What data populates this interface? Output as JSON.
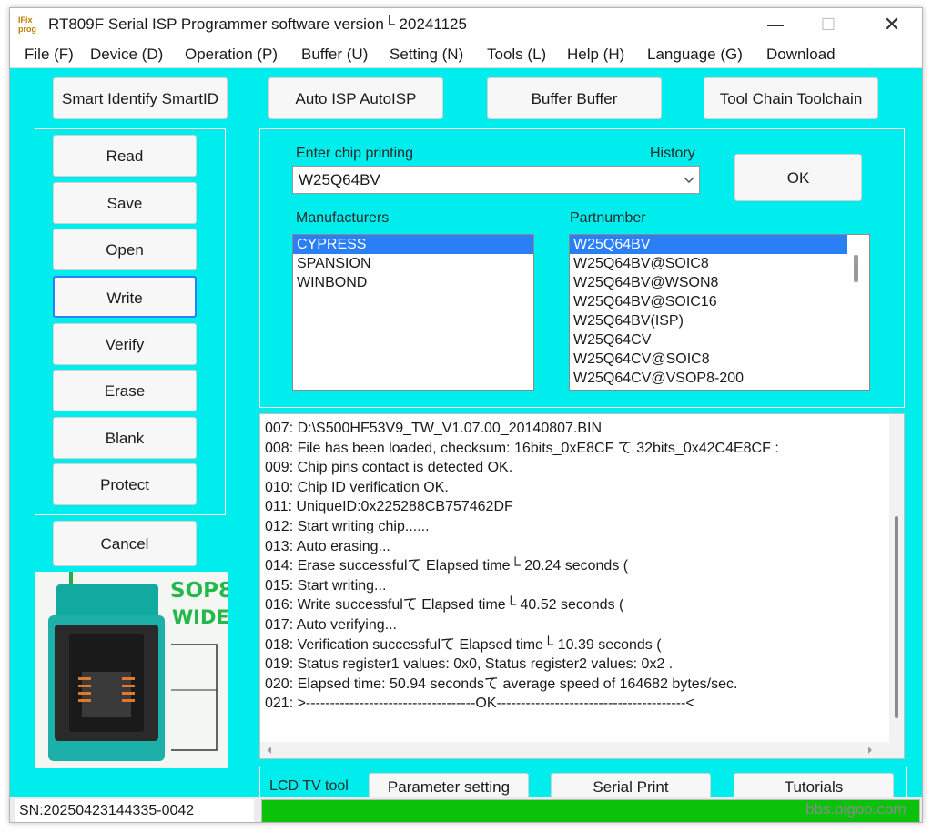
{
  "window": {
    "app_icon_text_1": "IFix",
    "app_icon_text_2": "prog",
    "title": "RT809F Serial ISP Programmer software version└ 20241125",
    "min_glyph": "—",
    "max_glyph": "☐",
    "close_glyph": "✕"
  },
  "menu": [
    "File (F)",
    "Device (D)",
    "Operation (P)",
    "Buffer (U)",
    "Setting (N)",
    "Tools (L)",
    "Help (H)",
    "Language (G)",
    "Download"
  ],
  "toolbar": {
    "smart_identify": "Smart Identify SmartID",
    "auto_isp": "Auto ISP AutoISP",
    "buffer": "Buffer Buffer",
    "tool_chain": "Tool Chain Toolchain"
  },
  "side_buttons": [
    "Read",
    "Save",
    "Open",
    "Write",
    "Verify",
    "Erase",
    "Blank",
    "Protect"
  ],
  "cancel_label": "Cancel",
  "socket": {
    "label_1": "SOP8",
    "label_2": "WIDE"
  },
  "chip": {
    "enter_label": "Enter chip printing",
    "history_label": "History",
    "value": "W25Q64BV",
    "ok_label": "OK",
    "manufacturers_label": "Manufacturers",
    "partnumber_label": "Partnumber",
    "manufacturers": [
      "CYPRESS",
      "SPANSION",
      "WINBOND"
    ],
    "partnumbers": [
      "W25Q64BV",
      "W25Q64BV@SOIC8",
      "W25Q64BV@WSON8",
      "W25Q64BV@SOIC16",
      "W25Q64BV(ISP)",
      "W25Q64CV",
      "W25Q64CV@SOIC8",
      "W25Q64CV@VSOP8-200"
    ]
  },
  "log": [
    "007:  D:\\S500HF53V9_TW_V1.07.00_20140807.BIN",
    "008:  File has been loaded, checksum: 16bits_0xE8CF て 32bits_0x42C4E8CF :",
    "009:  Chip pins contact is detected OK.",
    "010:  Chip ID verification OK.",
    "011:  UniqueID:0x225288CB757462DF",
    "012:  Start writing chip......",
    "013:  Auto erasing...",
    "014:  Erase successfulて Elapsed time└ 20.24 seconds (",
    "015:  Start writing...",
    "016:  Write successfulて Elapsed time└ 40.52 seconds (",
    "017:  Auto verifying...",
    "018:  Verification successfulて Elapsed time└ 10.39 seconds (",
    "019:  Status register1 values: 0x0, Status register2 values: 0x2 .",
    "020:  Elapsed time: 50.94 secondsて average speed of 164682 bytes/sec.",
    "021:  >-----------------------------------OK---------------------------------------<"
  ],
  "bottom": {
    "lcd_tv_tool": "LCD TV tool",
    "parameter_setting": "Parameter setting",
    "serial_print": "Serial Print",
    "tutorials": "Tutorials"
  },
  "status": {
    "sn": "SN:20250423144335-0042",
    "progress": 1.0,
    "watermark": "bbs.pigoo.com"
  },
  "colors": {
    "background": "#00eded",
    "selection": "#2a7ff5",
    "progress": "#0bc20b"
  }
}
